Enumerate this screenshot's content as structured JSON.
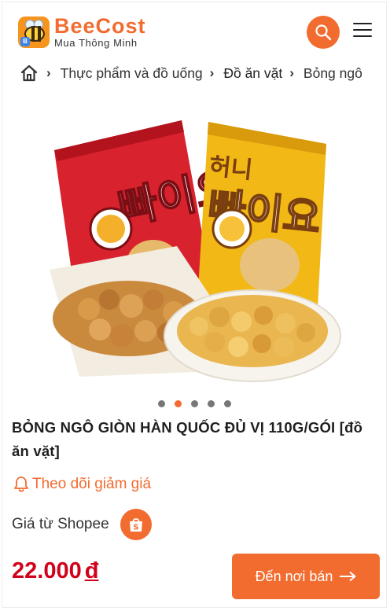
{
  "header": {
    "brand_name": "BeeCost",
    "brand_tagline": "Mua Thông Minh",
    "logo_badge": "B",
    "search_icon": "search-icon",
    "menu_icon": "hamburger-menu-icon"
  },
  "breadcrumb": {
    "home_icon": "home-icon",
    "items": [
      "Thực phẩm và đồ uống",
      "Đồ ăn vặt",
      "Bỏng ngô"
    ]
  },
  "carousel": {
    "dot_count": 5,
    "active_index": 1,
    "bag_left_text": "빠이요",
    "bag_right_top": "허니",
    "bag_right_text": "빠이요"
  },
  "product": {
    "title": "BỎNG NGÔ GIÒN HÀN QUỐC ĐỦ VỊ 110G/GÓI [đồ ăn vặt]",
    "follow_label": "Theo dõi giảm giá",
    "source_label": "Giá từ Shopee",
    "price": "22.000",
    "currency": "đ",
    "buy_label": "Đến nơi bán"
  },
  "colors": {
    "accent": "#f26b2f",
    "price": "#d0021b"
  }
}
